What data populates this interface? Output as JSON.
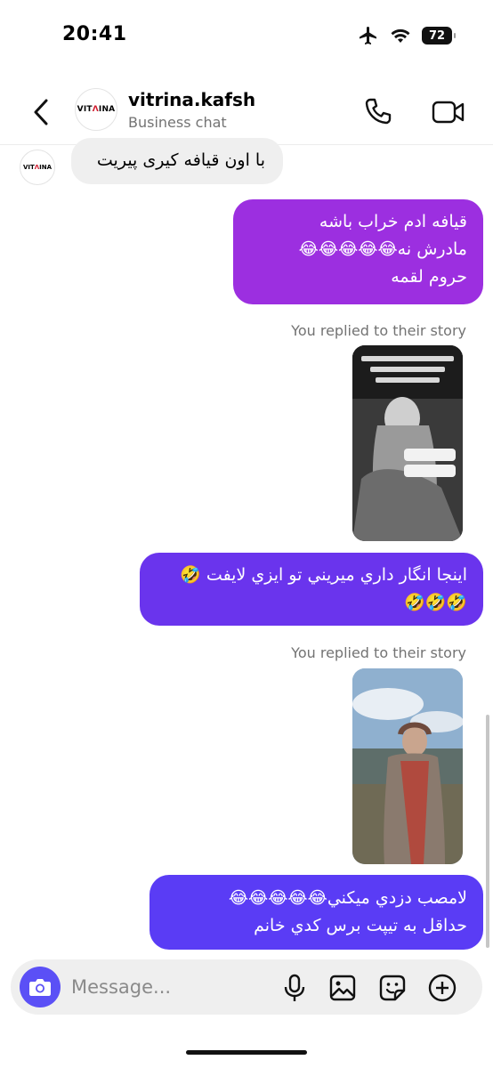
{
  "status_bar": {
    "time": "20:41",
    "battery": "72"
  },
  "header": {
    "name": "vitrina.kafsh",
    "subtitle": "Business chat",
    "avatar_text_a": "VIT",
    "avatar_text_b": "INA"
  },
  "messages": {
    "incoming_1": "با اون قیافه کیری پیریت",
    "outgoing_1": {
      "line1": "قیافه ادم خراب باشه",
      "line2": "مادرش نه😂😂😂😂😂",
      "line3": "حروم لقمه"
    },
    "story_reply_1": "You replied to their story",
    "outgoing_2": {
      "line1": "اينجا انگار داري ميريني تو ايزي لايفت 🤣",
      "line2": "🤣🤣🤣"
    },
    "story_reply_2": "You replied to their story",
    "outgoing_3": {
      "line1": "لامصب دزدي ميكني😂😂😂😂😂",
      "line2": "حداقل به تيپت برس كدي خانم"
    }
  },
  "composer": {
    "placeholder": "Message..."
  },
  "icons": {
    "back": "chevron-left-icon",
    "call": "phone-icon",
    "video": "video-camera-icon",
    "camera": "camera-icon",
    "mic": "microphone-icon",
    "gallery": "image-icon",
    "sticker": "sticker-icon",
    "add": "plus-circle-icon"
  },
  "colors": {
    "outgoing_1": "#9c2fe0",
    "outgoing_2": "#6a34ed",
    "outgoing_3": "#5a3cf5",
    "incoming": "#efefef",
    "camera_button": "#5b50f6"
  }
}
